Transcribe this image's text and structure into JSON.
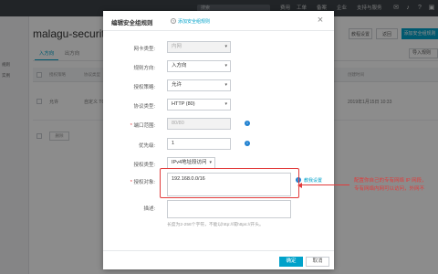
{
  "topbar": {
    "search_placeholder": "搜索",
    "links": [
      "费用",
      "工单",
      "备案",
      "企业",
      "支持与服务"
    ],
    "icons": [
      "mail-icon",
      "bell-icon",
      "help-icon",
      "cart-icon"
    ]
  },
  "sidebar": {
    "items": [
      "规则",
      "实例"
    ]
  },
  "page": {
    "title": "malagu-security",
    "buttons": {
      "tutorial": "教程设置",
      "back": "返回",
      "add_rule": "添加安全组规则"
    },
    "tabs": [
      "入方向",
      "出方向"
    ],
    "import_label": "导入规则",
    "table": {
      "headers": [
        "授权策略",
        "协议类型",
        "端口范围",
        "授权类型",
        "授权对象",
        "描述",
        "优先级",
        "创建时间"
      ],
      "row": {
        "policy": "允许",
        "protocol": "自定义 TCP",
        "time": "2019年1月15日 10:33"
      }
    },
    "bulk_delete": "删除"
  },
  "dialog": {
    "title": "编辑安全组规则",
    "help_link": "添加安全组规则",
    "fields": {
      "nic_type": {
        "label": "网卡类型:",
        "value": "内网"
      },
      "direction": {
        "label": "规则方向:",
        "value": "入方向"
      },
      "policy": {
        "label": "授权策略:",
        "value": "允许"
      },
      "protocol": {
        "label": "协议类型:",
        "value": "HTTP (80)"
      },
      "port_range": {
        "label": "端口范围:",
        "value": "80/80"
      },
      "priority": {
        "label": "优先级:",
        "value": "1"
      },
      "auth_type": {
        "label": "授权类型:",
        "value": "IPv4地址段访问"
      },
      "auth_object": {
        "label": "授权对象:",
        "value": "192.168.0.0/16",
        "tutorial_link": "教我设置"
      },
      "description": {
        "label": "描述:",
        "hint": "长度为2-256个字符，不能以http://或https://开头。"
      }
    },
    "confirm": "确定",
    "cancel": "取消"
  },
  "annotation": {
    "line1": "配置你自己的专有网络 IP 网段，",
    "line2": "专有网络内网可以访问，外网不"
  },
  "colors": {
    "accent": "#00a2ca",
    "annotation": "#e23b3b",
    "topbar": "#3d4247"
  }
}
